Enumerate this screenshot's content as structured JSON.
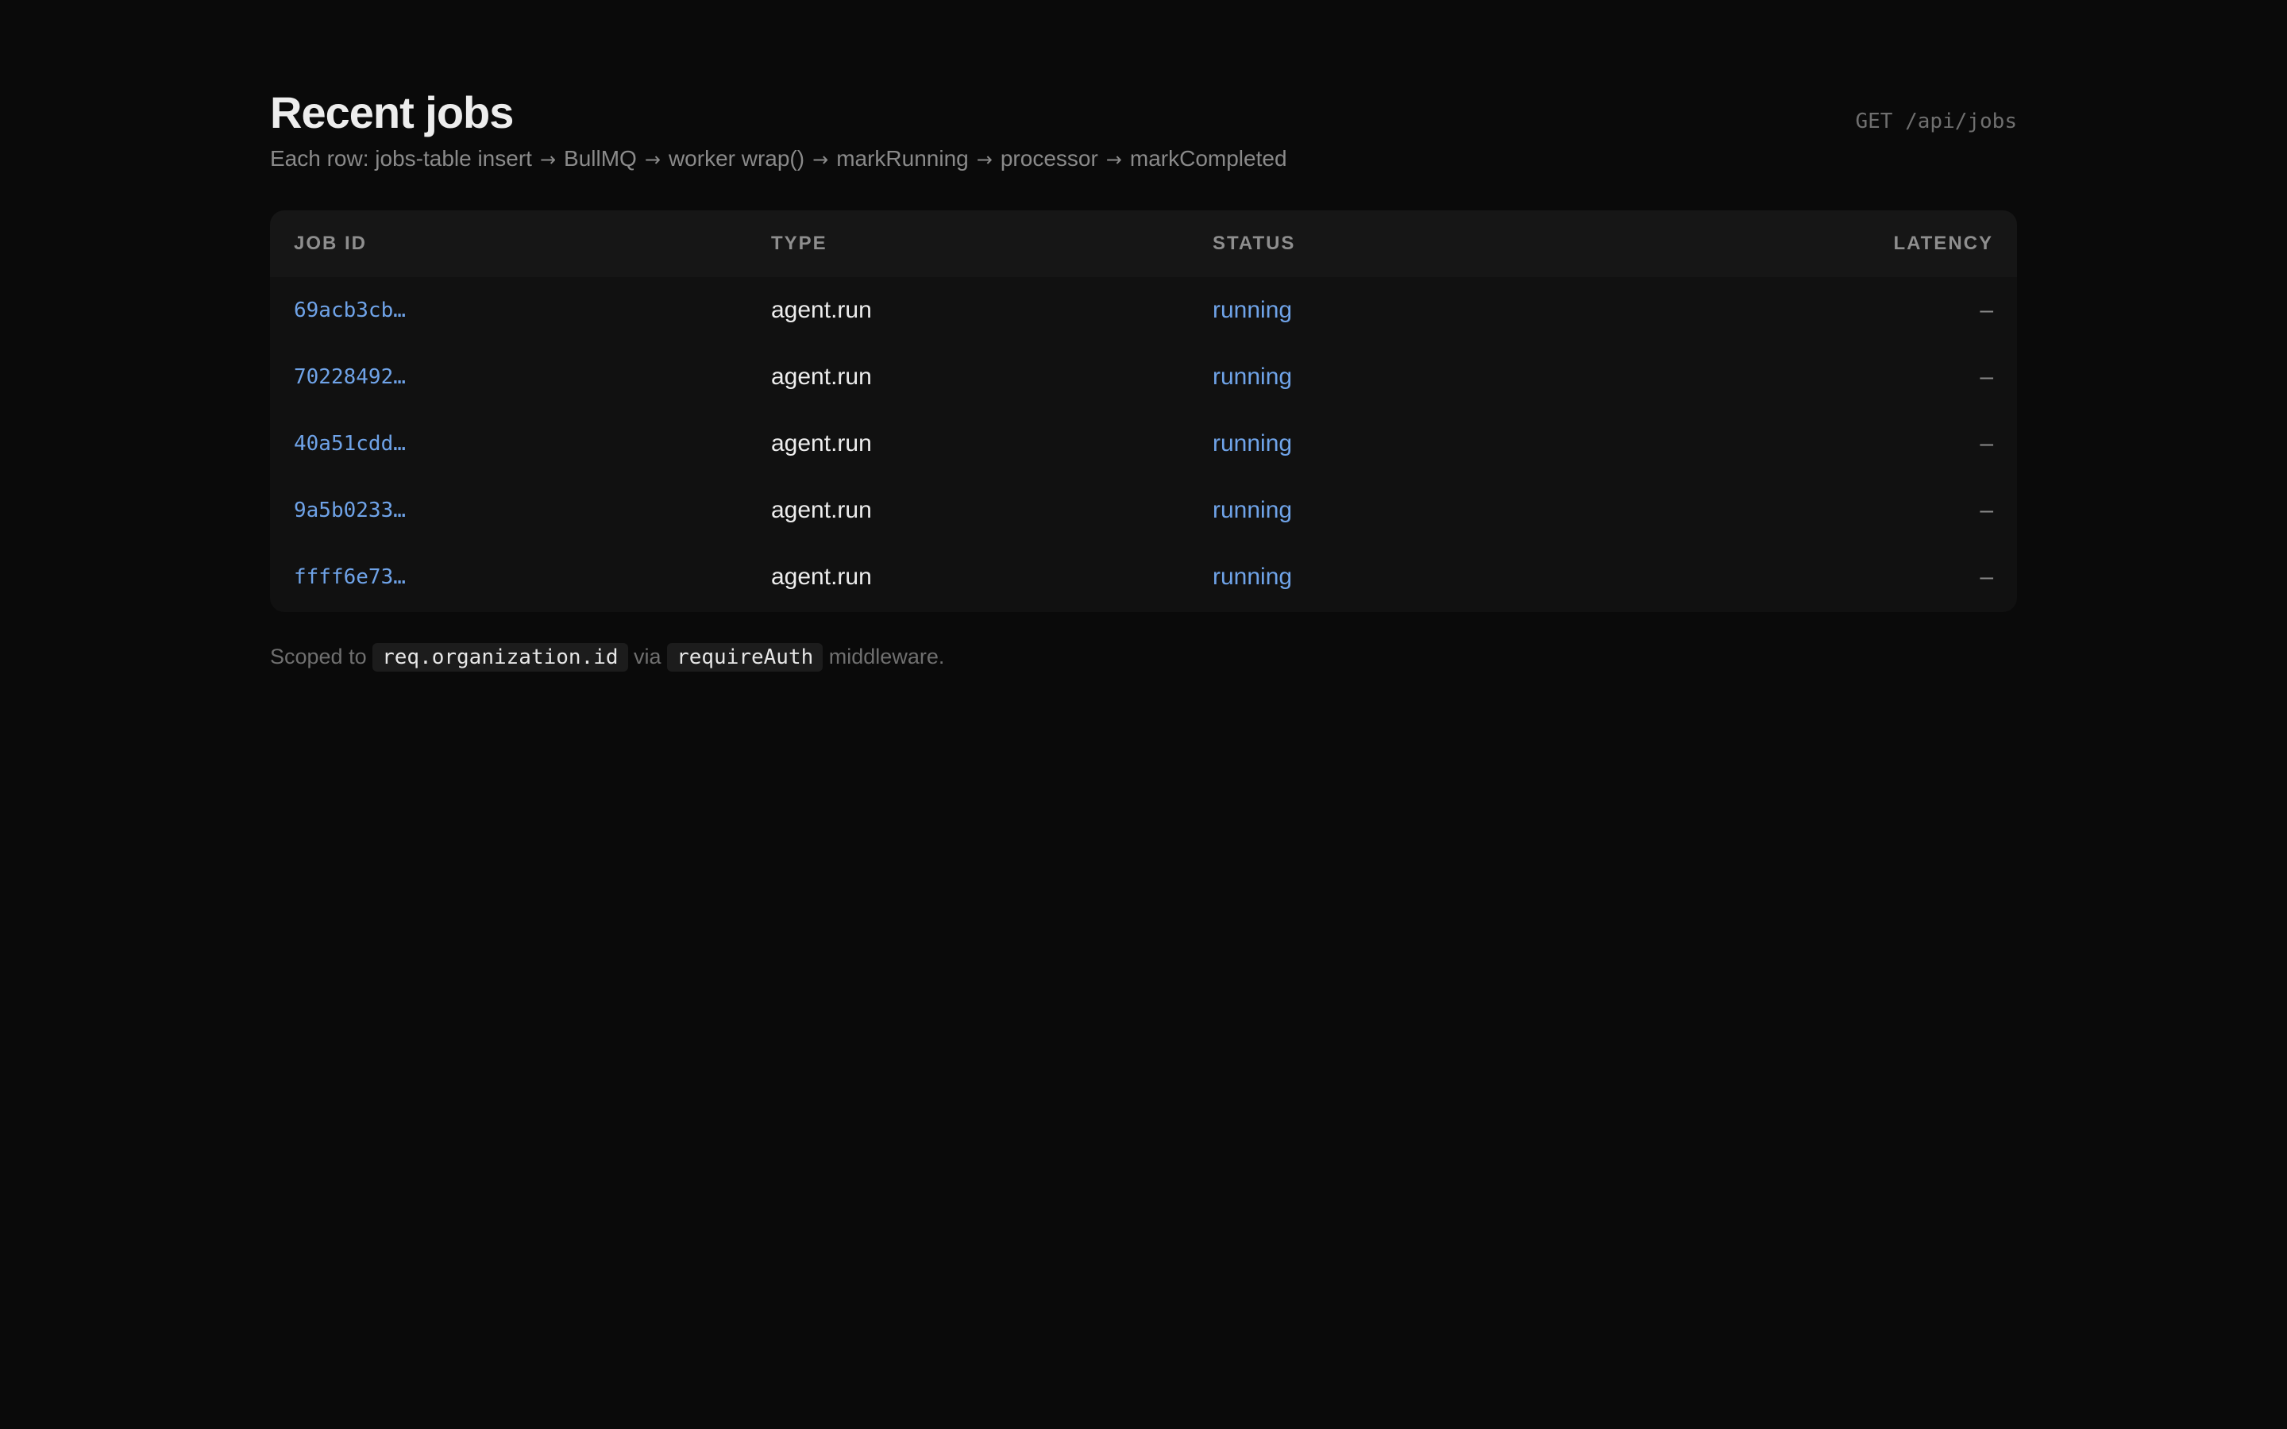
{
  "header": {
    "title": "Recent jobs",
    "subtitle_steps": [
      "Each row: jobs-table insert",
      "BullMQ",
      "worker wrap()",
      "markRunning",
      "processor",
      "markCompleted"
    ],
    "arrow": "→",
    "endpoint": "GET /api/jobs"
  },
  "table": {
    "columns": {
      "job_id": "JOB ID",
      "type": "TYPE",
      "status": "STATUS",
      "latency": "LATENCY"
    },
    "rows": [
      {
        "job_id": "69acb3cb…",
        "type": "agent.run",
        "status": "running",
        "latency": "–"
      },
      {
        "job_id": "70228492…",
        "type": "agent.run",
        "status": "running",
        "latency": "–"
      },
      {
        "job_id": "40a51cdd…",
        "type": "agent.run",
        "status": "running",
        "latency": "–"
      },
      {
        "job_id": "9a5b0233…",
        "type": "agent.run",
        "status": "running",
        "latency": "–"
      },
      {
        "job_id": "ffff6e73…",
        "type": "agent.run",
        "status": "running",
        "latency": "–"
      }
    ]
  },
  "footer": {
    "prefix": "Scoped to",
    "code1": "req.organization.id",
    "middle": "via",
    "code2": "requireAuth",
    "suffix": "middleware."
  },
  "colors": {
    "background": "#0a0a0a",
    "card": "#111111",
    "accent": "#6fa3e8"
  }
}
